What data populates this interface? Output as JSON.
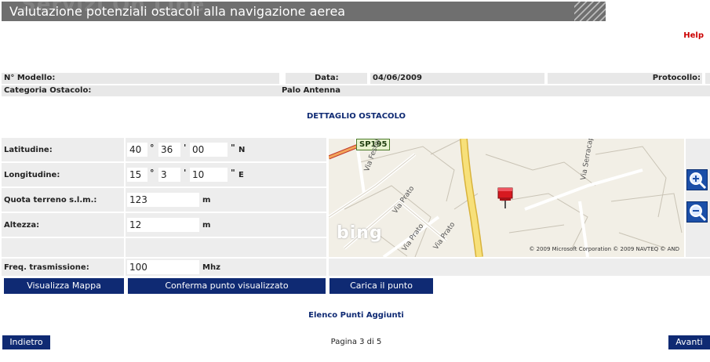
{
  "header": {
    "title": "Valutazione potenziali ostacoli alla navigazione aerea",
    "watermark": "Servizi On Line"
  },
  "help": "Help",
  "info": {
    "modello_label": "N° Modello:",
    "data_label": "Data:",
    "data_value": "04/06/2009",
    "protocollo_label": "Protocollo:",
    "categoria_label": "Categoria Ostacolo:",
    "categoria_value": "Palo Antenna"
  },
  "section_title": "DETTAGLIO OSTACOLO",
  "form": {
    "latitudine": {
      "label": "Latitudine:",
      "deg": "40",
      "min": "36",
      "sec": "00",
      "hemi": "N"
    },
    "longitudine": {
      "label": "Longitudine:",
      "deg": "15",
      "min": "3",
      "sec": "10",
      "hemi": "E"
    },
    "quota": {
      "label": "Quota terreno s.l.m.:",
      "value": "123",
      "unit": "m"
    },
    "altezza": {
      "label": "Altezza:",
      "value": "12",
      "unit": "m"
    },
    "freq": {
      "label": "Freq. trasmissione:",
      "value": "100",
      "unit": "Mhz"
    },
    "symbols": {
      "deg": "°",
      "min": "'",
      "sec": "\""
    }
  },
  "map": {
    "road_badge": "SP195",
    "streets": [
      "Via Festola",
      "Via Prato",
      "Via Prato",
      "Via Prato",
      "Via Serracapi"
    ],
    "logo": "bing",
    "copyright": "© 2009 Microsoft Corporation   © 2009 NAVTEQ   © AND",
    "marker_color": "#d71920",
    "road_color": "#f7e07a"
  },
  "buttons": {
    "visualizza": "Visualizza Mappa",
    "conferma": "Conferma punto visualizzato",
    "carica": "Carica il punto",
    "indietro": "Indietro",
    "avanti": "Avanti"
  },
  "elenco": "Elenco Punti Aggiunti",
  "pagination": "Pagina 3 di 5",
  "colors": {
    "accent": "#0f2a73",
    "title_bar": "#6f6f6f",
    "help": "#cc0000"
  }
}
